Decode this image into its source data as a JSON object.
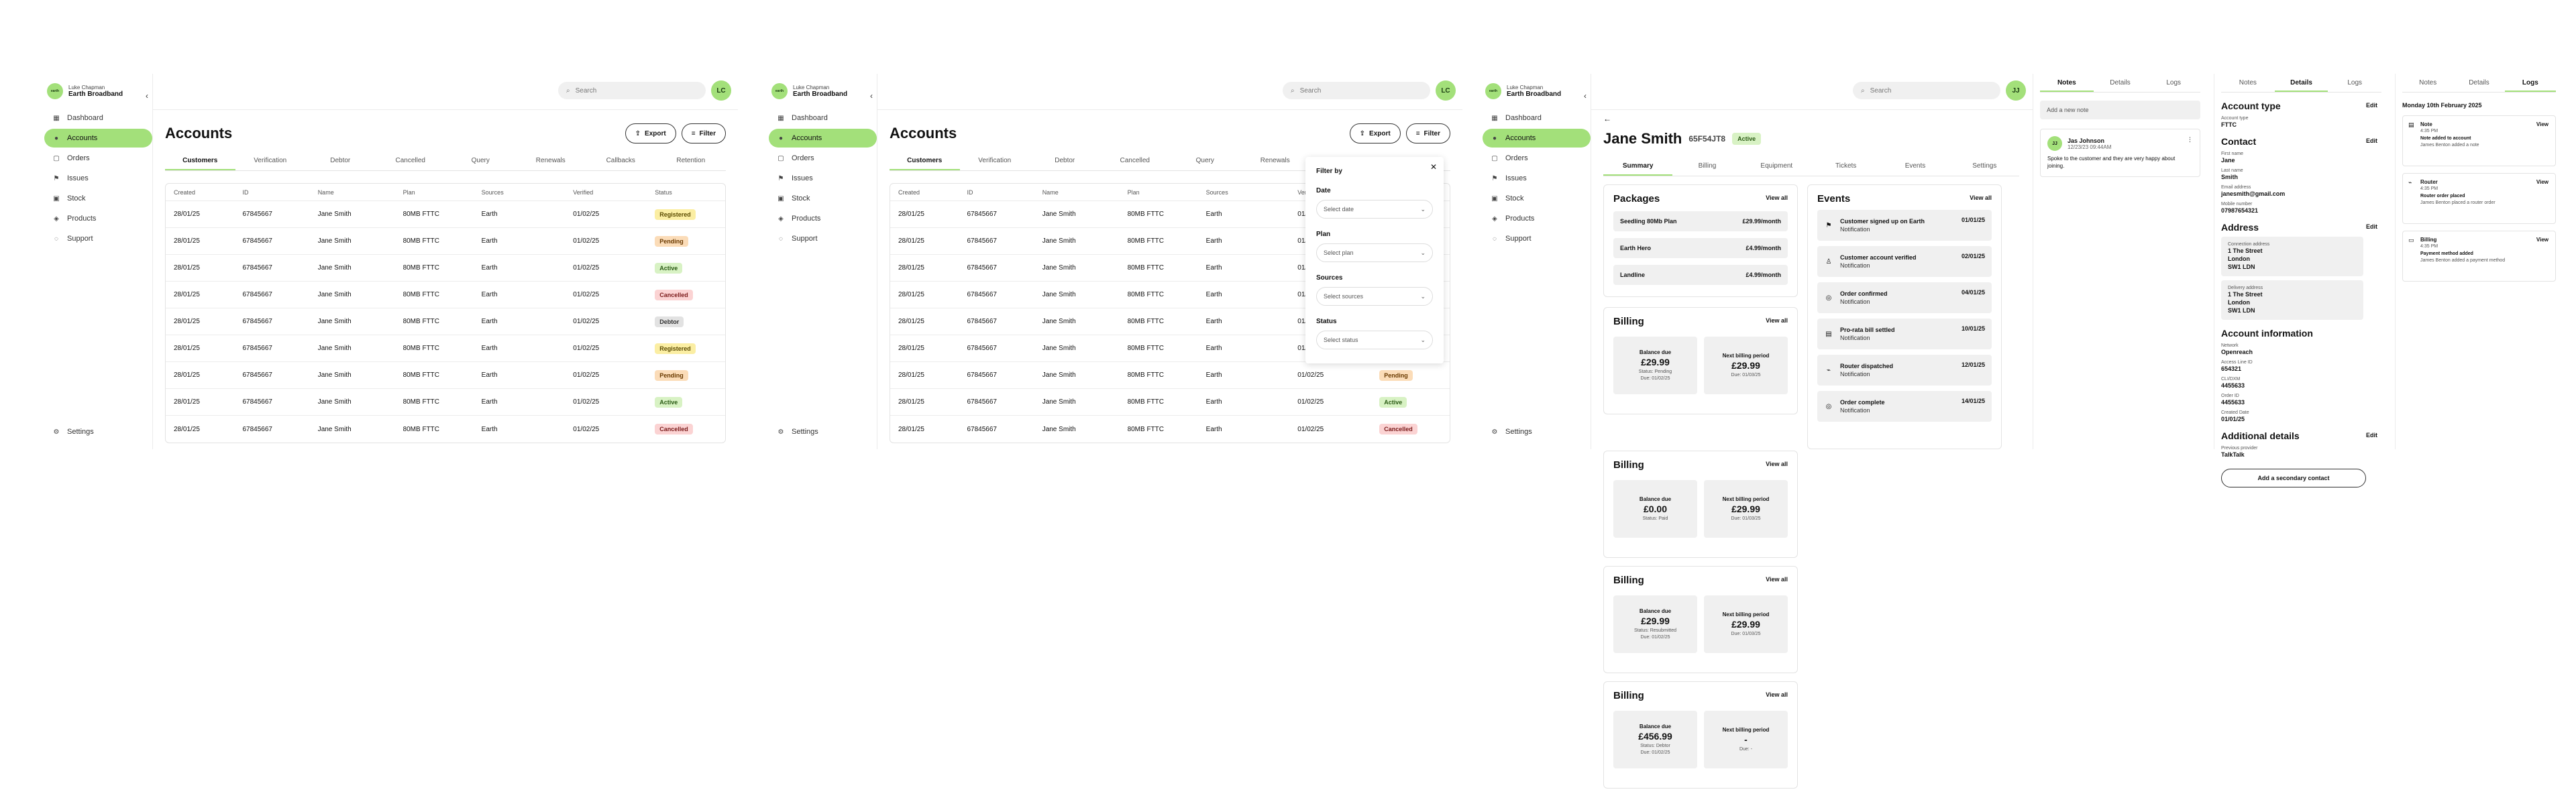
{
  "brand": {
    "user": "Luke Chapman",
    "name": "Earth Broadband",
    "logo": "earth"
  },
  "nav": [
    {
      "label": "Dashboard",
      "icon": "dashboard-icon",
      "glyph": "▦"
    },
    {
      "label": "Accounts",
      "icon": "user-icon",
      "glyph": "●"
    },
    {
      "label": "Orders",
      "icon": "orders-icon",
      "glyph": "▢"
    },
    {
      "label": "Issues",
      "icon": "flag-icon",
      "glyph": "⚑"
    },
    {
      "label": "Stock",
      "icon": "box-icon",
      "glyph": "▣"
    },
    {
      "label": "Products",
      "icon": "tag-icon",
      "glyph": "◈"
    },
    {
      "label": "Support",
      "icon": "support-icon",
      "glyph": "◌"
    }
  ],
  "settings_label": "Settings",
  "search_placeholder": "Search",
  "avatars": [
    "LC",
    "LC",
    "JJ"
  ],
  "accounts": {
    "title": "Accounts",
    "export_label": "Export",
    "filter_label": "Filter",
    "tabs": [
      "Customers",
      "Verification",
      "Debtor",
      "Cancelled",
      "Query",
      "Renewals",
      "Callbacks",
      "Retention"
    ],
    "columns": [
      "Created",
      "ID",
      "Name",
      "Plan",
      "Sources",
      "Verified",
      "Status"
    ],
    "rows": [
      [
        "28/01/25",
        "67845667",
        "Jane Smith",
        "80MB FTTC",
        "Earth",
        "01/02/25",
        "Registered"
      ],
      [
        "28/01/25",
        "67845667",
        "Jane Smith",
        "80MB FTTC",
        "Earth",
        "01/02/25",
        "Pending"
      ],
      [
        "28/01/25",
        "67845667",
        "Jane Smith",
        "80MB FTTC",
        "Earth",
        "01/02/25",
        "Active"
      ],
      [
        "28/01/25",
        "67845667",
        "Jane Smith",
        "80MB FTTC",
        "Earth",
        "01/02/25",
        "Cancelled"
      ],
      [
        "28/01/25",
        "67845667",
        "Jane Smith",
        "80MB FTTC",
        "Earth",
        "01/02/25",
        "Debtor"
      ],
      [
        "28/01/25",
        "67845667",
        "Jane Smith",
        "80MB FTTC",
        "Earth",
        "01/02/25",
        "Registered"
      ],
      [
        "28/01/25",
        "67845667",
        "Jane Smith",
        "80MB FTTC",
        "Earth",
        "01/02/25",
        "Pending"
      ],
      [
        "28/01/25",
        "67845667",
        "Jane Smith",
        "80MB FTTC",
        "Earth",
        "01/02/25",
        "Active"
      ],
      [
        "28/01/25",
        "67845667",
        "Jane Smith",
        "80MB FTTC",
        "Earth",
        "01/02/25",
        "Cancelled"
      ]
    ]
  },
  "status_colors": {
    "Registered": {
      "bg": "#fbeea3",
      "fg": "#5a4a00"
    },
    "Pending": {
      "bg": "#fbdcb8",
      "fg": "#6a3a00"
    },
    "Active": {
      "bg": "#d8f2c4",
      "fg": "#2a5a14"
    },
    "Cancelled": {
      "bg": "#fbd3d3",
      "fg": "#7a1a1a"
    },
    "Debtor": {
      "bg": "#e2e2e2",
      "fg": "#333333"
    }
  },
  "filter": {
    "title": "Filter by",
    "fields": [
      {
        "label": "Date",
        "placeholder": "Select date"
      },
      {
        "label": "Plan",
        "placeholder": "Select plan"
      },
      {
        "label": "Sources",
        "placeholder": "Select sources"
      },
      {
        "label": "Status",
        "placeholder": "Select status"
      }
    ]
  },
  "customer": {
    "name": "Jane Smith",
    "id": "65F54JT8",
    "status": "Active",
    "tabs": [
      "Summary",
      "Billing",
      "Equipment",
      "Tickets",
      "Events",
      "Settings"
    ],
    "view_all": "View all",
    "packages_title": "Packages",
    "packages": [
      {
        "name": "Seedling 80Mb Plan",
        "price": "£29.99/month"
      },
      {
        "name": "Earth Hero",
        "price": "£4.99/month"
      },
      {
        "name": "Landline",
        "price": "£4.99/month"
      }
    ],
    "billing_title": "Billing",
    "balance_label": "Balance due",
    "next_label": "Next billing period",
    "billing_cards": [
      {
        "balance": "£29.99",
        "status": "Status: Pending",
        "due": "Due: 01/02/25",
        "next": "£29.99",
        "next_due": "Due: 01/03/25"
      },
      {
        "balance": "£0.00",
        "status": "Status: Paid",
        "due": "",
        "next": "£29.99",
        "next_due": "Due: 01/03/25"
      },
      {
        "balance": "£29.99",
        "status": "Status: Resubmitted",
        "due": "Due: 01/02/25",
        "next": "£29.99",
        "next_due": "Due: 01/03/25"
      },
      {
        "balance": "£456.99",
        "status": "Status: Debtor",
        "due": "Due: 01/02/25",
        "next": "-",
        "next_due": "Due: -"
      }
    ],
    "events_title": "Events",
    "events": [
      {
        "title": "Customer signed up on Earth",
        "sub": "Notification",
        "date": "01/01/25",
        "icon": "flag-icon",
        "glyph": "⚑"
      },
      {
        "title": "Customer account verified",
        "sub": "Notification",
        "date": "02/01/25",
        "icon": "user-icon",
        "glyph": "♙"
      },
      {
        "title": "Order confirmed",
        "sub": "Notification",
        "date": "04/01/25",
        "icon": "check-circle-icon",
        "glyph": "◎"
      },
      {
        "title": "Pro-rata bill settled",
        "sub": "Notification",
        "date": "10/01/25",
        "icon": "document-icon",
        "glyph": "▤"
      },
      {
        "title": "Router dispatched",
        "sub": "Notification",
        "date": "12/01/25",
        "icon": "router-icon",
        "glyph": "⌁"
      },
      {
        "title": "Order complete",
        "sub": "Notification",
        "date": "14/01/25",
        "icon": "check-circle-icon",
        "glyph": "◎"
      }
    ]
  },
  "panel_tabs": [
    "Notes",
    "Details",
    "Logs"
  ],
  "notes": {
    "input_placeholder": "Add a new note",
    "author_initials": "JJ",
    "author": "Jas Johnson",
    "time": "12/23/23 09:44AM",
    "body": "Spoke to the customer and they are very happy about joining."
  },
  "details": {
    "edit_label": "Edit",
    "account_type_title": "Account type",
    "account_type_label": "Account type",
    "account_type_value": "FTTC",
    "contact_title": "Contact",
    "contact": [
      {
        "label": "First name",
        "value": "Jane"
      },
      {
        "label": "Last name",
        "value": "Smith"
      },
      {
        "label": "Email address",
        "value": "janesmith@gmail.com"
      },
      {
        "label": "Mobile number",
        "value": "07987654321"
      }
    ],
    "address_title": "Address",
    "connection_label": "Connection address",
    "connection_lines": [
      "1 The Street",
      "London",
      "SW1 LDN"
    ],
    "delivery_label": "Delivery address",
    "delivery_lines": [
      "1 The Street",
      "London",
      "SW1 LDN"
    ],
    "account_info_title": "Account information",
    "account_info": [
      {
        "label": "Network",
        "value": "Openreach"
      },
      {
        "label": "Access Line ID",
        "value": "654321"
      },
      {
        "label": "CLI/DXM",
        "value": "4455633"
      },
      {
        "label": "Order ID",
        "value": "4455633"
      },
      {
        "label": "Created Date",
        "value": "01/01/25"
      }
    ],
    "additional_title": "Additional details",
    "additional": [
      {
        "label": "Previous provider",
        "value": "TalkTalk"
      }
    ],
    "secondary_contact_label": "Add a secondary contact"
  },
  "logs": {
    "date": "Monday 10th February 2025",
    "view_label": "View",
    "items": [
      {
        "title": "Note",
        "time": "4:35 PM",
        "body": "Note added to account",
        "sub": "James Benton added a note",
        "icon": "note-icon",
        "glyph": "▤"
      },
      {
        "title": "Router",
        "time": "4:35 PM",
        "body": "Router order placed",
        "sub": "James Benton placed a router order",
        "icon": "router-icon",
        "glyph": "⌁"
      },
      {
        "title": "Billing",
        "time": "4:35 PM",
        "body": "Payment method added",
        "sub": "James Benton added a payment method",
        "icon": "card-icon",
        "glyph": "▭"
      }
    ]
  }
}
